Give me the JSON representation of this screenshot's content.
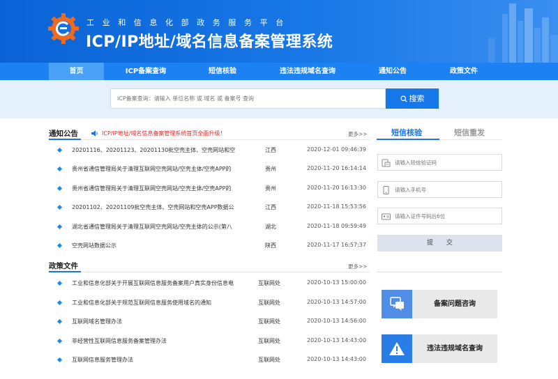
{
  "header": {
    "subtitle": "工业和信息化部政务服务平台",
    "title": "ICP/IP地址/域名信息备案管理系统"
  },
  "nav": {
    "items": [
      {
        "label": "首页",
        "active": true
      },
      {
        "label": "ICP备案查询",
        "active": false
      },
      {
        "label": "短信核验",
        "active": false
      },
      {
        "label": "违法违规域名查询",
        "active": false
      },
      {
        "label": "通知公告",
        "active": false
      },
      {
        "label": "政策文件",
        "active": false
      }
    ]
  },
  "search": {
    "placeholder": "ICP备案查询：请输入 单位名称 或 域名 或 备案号 查询",
    "button_label": "搜索"
  },
  "notices": {
    "title": "通知公告",
    "marquee": "ICP/IP地址/域名信息备案管理系统首页全面升级！",
    "more": "更多>>",
    "items": [
      {
        "title": "20201116、20201123、20201130批空壳主体、空壳网站和空",
        "region": "江西",
        "date": "2020-12-01 09:46:39"
      },
      {
        "title": "贵州省通信管理局关于清理互联网空壳网站/空壳主体/空壳APP的",
        "region": "贵州",
        "date": "2020-11-20 16:14:14"
      },
      {
        "title": "贵州省通信管理局关于清理互联网空壳网站/空壳主体/空壳APP的",
        "region": "贵州",
        "date": "2020-11-20 16:13:30"
      },
      {
        "title": "20201102、20201109批空壳主体、空壳网站和空壳APP数据公",
        "region": "江西",
        "date": "2020-11-18 15:53:56"
      },
      {
        "title": "湖北省通信管理局关于清理互联网空壳网站/空壳主体的公示(第八",
        "region": "湖北",
        "date": "2020-11-18 09:59:49"
      },
      {
        "title": "空壳网站数据公示",
        "region": "陕西",
        "date": "2020-11-17 16:57:37"
      }
    ]
  },
  "policies": {
    "title": "政策文件",
    "more": "更多>>",
    "items": [
      {
        "title": "工业和信息化部关于开展互联网信息服务备案用户真实身份信息电",
        "region": "互联网处",
        "date": "2020-10-13 15:00:00"
      },
      {
        "title": "工业和信息化部关于规范互联网信息服务使用域名的通知",
        "region": "互联网处",
        "date": "2020-10-13 14:57:00"
      },
      {
        "title": "互联网域名管理办法",
        "region": "互联网处",
        "date": "2020-10-13 14:56:00"
      },
      {
        "title": "非经营性互联网信息服务备案管理办法",
        "region": "互联网处",
        "date": "2020-10-13 14:43:00"
      },
      {
        "title": "互联网信息服务管理办法",
        "region": "互联网处",
        "date": "2020-10-13 14:43:00"
      }
    ]
  },
  "sms": {
    "tab_verify": "短信核验",
    "tab_resend": "短信重发",
    "code_placeholder": "请输入短信验证码",
    "phone_placeholder": "请输入手机号",
    "id_placeholder": "请输入证件号码后6位",
    "submit_label": "提 交"
  },
  "cards": {
    "consult": "备案问题咨询",
    "illegal": "违法违规域名查询"
  },
  "colors": {
    "brand_blue": "#1677e8",
    "nav_blue": "#1c82f3",
    "alert_red": "#e02b2b"
  }
}
